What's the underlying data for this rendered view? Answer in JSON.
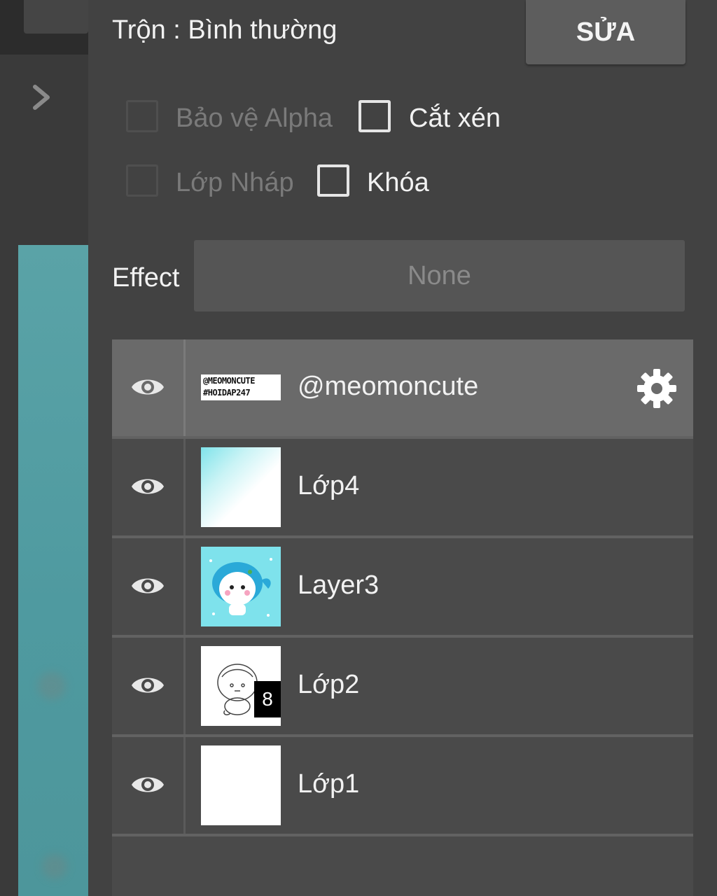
{
  "blend": {
    "label": "Trộn : Bình thường",
    "edit_button": "SỬA"
  },
  "options": [
    {
      "label": "Bảo vệ Alpha",
      "checked": false,
      "enabled": false
    },
    {
      "label": "Cắt xén",
      "checked": false,
      "enabled": true
    },
    {
      "label": "Lớp Nháp",
      "checked": false,
      "enabled": false
    },
    {
      "label": "Khóa",
      "checked": false,
      "enabled": true
    }
  ],
  "effect": {
    "label": "Effect",
    "value": "None"
  },
  "layers": [
    {
      "name": "@meomoncute",
      "visible": true,
      "selected": true,
      "thumb": "banner",
      "thumb_text": [
        "@MEOMONCUTE",
        "#HOIDAP247"
      ]
    },
    {
      "name": "Lớp4",
      "visible": true,
      "selected": false,
      "thumb": "gradient"
    },
    {
      "name": "Layer3",
      "visible": true,
      "selected": false,
      "thumb": "character"
    },
    {
      "name": "Lớp2",
      "visible": true,
      "selected": false,
      "thumb": "sketch",
      "badge": "8"
    },
    {
      "name": "Lớp1",
      "visible": true,
      "selected": false,
      "thumb": "blank"
    }
  ],
  "icons": {
    "expand": "chevron-right-icon",
    "visibility": "eye-icon",
    "settings": "gear-icon"
  },
  "colors": {
    "panel": "#424242",
    "selected_row": "#6a6a6a",
    "row": "#4a4a4a",
    "canvas": "#5aa3a7"
  }
}
